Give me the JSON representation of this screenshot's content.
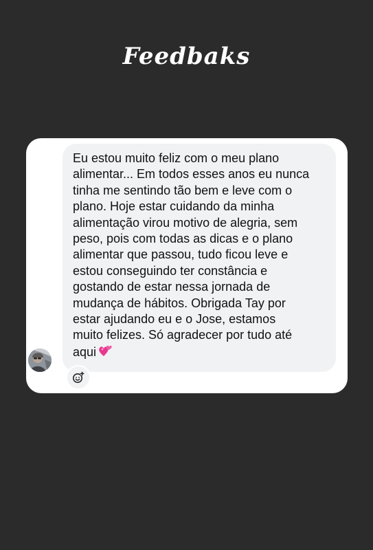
{
  "header": {
    "title": "Feedbaks"
  },
  "message": {
    "text": "Eu estou muito feliz com o meu plano\nalimentar... Em todos esses anos eu nunca\ntinha me sentindo tão bem e leve com o\nplano. Hoje estar cuidando da minha\nalimentação virou motivo de alegria, sem\npeso, pois com todas as dicas e o plano\nalimentar que passou, tudo ficou leve e\nestou conseguindo ter constância e\ngostando de estar nessa jornada de\nmudança de hábitos. Obrigada Tay por\nestar ajudando eu e o Jose, estamos\nmuito felizes. Só agradecer por tudo até\naqui",
    "emoji_icon": "two-hearts-icon",
    "sender_avatar_icon": "user-avatar",
    "reaction_icon": "add-reaction-icon"
  },
  "colors": {
    "background": "#2b2b2b",
    "card": "#ffffff",
    "bubble": "#f1f2f4",
    "text": "#111111",
    "heart": "#e8388f"
  }
}
